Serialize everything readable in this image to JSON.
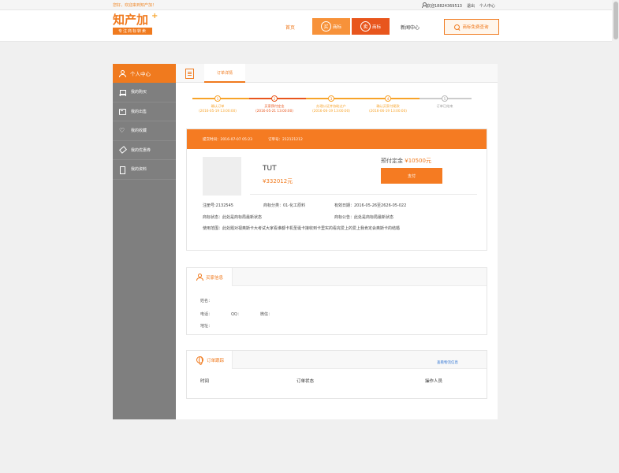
{
  "topbar": {
    "welcome": "您好，欢迎来到知产加！",
    "user": "欢迎18824369513",
    "logout": "退出",
    "personal_center": "个人中心"
  },
  "header": {
    "logo_name": "知产加",
    "logo_slogan": "专注商标转卖",
    "nav_home": "首页",
    "buy_badge": "买",
    "buy_label": "商标",
    "sell_badge": "卖",
    "sell_label": "商标",
    "nav_news": "新闻中心",
    "free_query": "商标免费查询"
  },
  "sidebar": {
    "title": "个人中心",
    "items": [
      {
        "label": "我的购买",
        "icon": "cart-icon"
      },
      {
        "label": "我的出售",
        "icon": "sell-icon"
      },
      {
        "label": "我的收藏",
        "icon": "heart-icon"
      },
      {
        "label": "我的优惠券",
        "icon": "tag-icon"
      },
      {
        "label": "我的资料",
        "icon": "document-icon"
      }
    ]
  },
  "main": {
    "tab": "订单详情",
    "steps": [
      {
        "num": "1",
        "label": "确认订单",
        "date": "(2016-05-19 13:00:00)",
        "state": "done"
      },
      {
        "num": "2",
        "label": "买家预付定金",
        "date": "(2016-05-21 13:00:00)",
        "state": "current"
      },
      {
        "num": "3",
        "label": "办理公证并协助过户",
        "date": "(2016-06-19 13:00:00)",
        "state": "done"
      },
      {
        "num": "4",
        "label": "确认买家付尾款",
        "date": "(2016-06-19 13:00:00)",
        "state": "done"
      },
      {
        "num": "5",
        "label": "订单已结束",
        "date": "",
        "state": "pending"
      }
    ],
    "order": {
      "submit_time": "提交时间：2016-07-07  05:23",
      "order_no": "订单号：212121212",
      "tm_name": "TUT",
      "tm_price": "¥332012元",
      "deposit_label": "预付定金",
      "deposit_amount": "¥10500元",
      "pay_button": "支付",
      "reg_no": "注册号:2132545",
      "category": "商标分类：01-化工原料",
      "validity": "有效日期：2016-05-26至2626-05-022",
      "tm_status": "商标状态：此处是商标局最新状态",
      "tm_notice": "商标公告：此处是商标局最新状态",
      "scope": "使用范围：此处题对视奥斯卡大考试大家看谁都卡机圣诞卡接收到卡里实的看完爱上的爱上我肯定会奥斯卡的结婚"
    },
    "buyer": {
      "title": "买家信息",
      "name_label": "姓名：",
      "phone_label": "电话：",
      "qq_label": "QQ：",
      "wechat_label": "微信：",
      "address_label": "地址："
    },
    "tracking": {
      "title": "订单跟踪",
      "link": "查看物流信息",
      "columns": [
        "时间",
        "订单状态",
        "操作人员"
      ]
    }
  },
  "colors": {
    "accent": "#f07a1e",
    "accent_dark": "#e8561d",
    "sidebar_bg": "#7f7f7f"
  }
}
